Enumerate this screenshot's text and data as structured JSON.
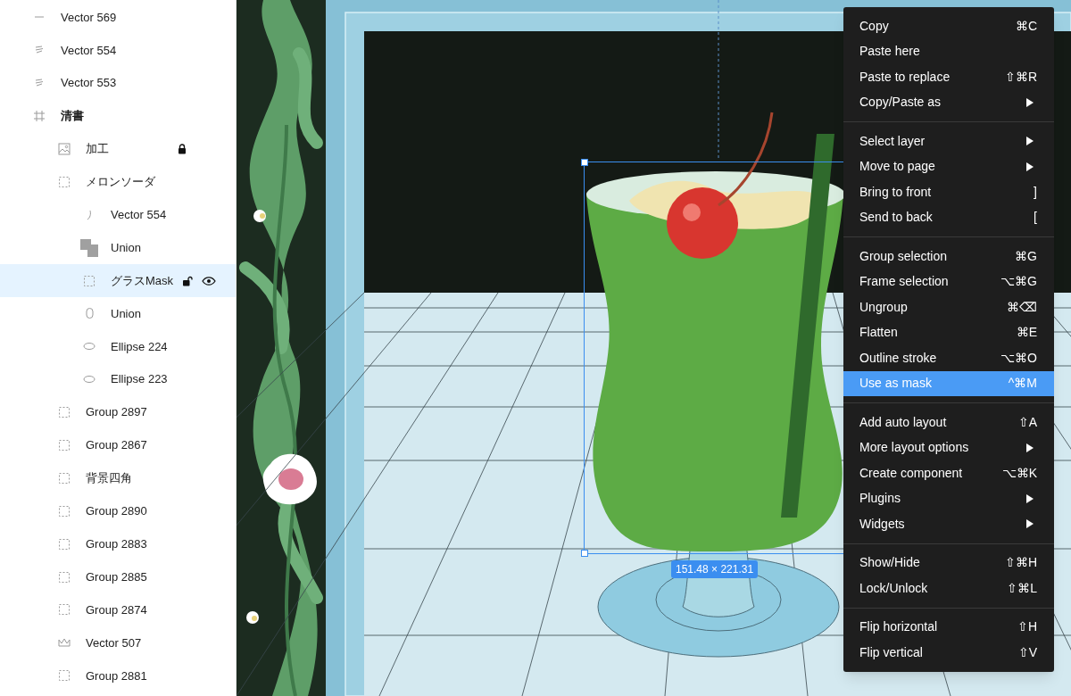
{
  "layers": [
    {
      "children": [
        {
          "name": "Vector 569",
          "kind": "line",
          "selected": false,
          "locked": false,
          "hovered": false
        },
        {
          "name": "Vector 554",
          "kind": "squiggle",
          "selected": false,
          "locked": false,
          "hovered": false
        },
        {
          "name": "Vector 553",
          "kind": "squiggle",
          "selected": false,
          "locked": false,
          "hovered": false
        }
      ]
    },
    {
      "name": "清書",
      "kind": "frame",
      "selected": false,
      "locked": false,
      "hovered": false,
      "children": [
        {
          "name": "加工",
          "kind": "image",
          "selected": false,
          "locked": true,
          "hovered": false
        },
        {
          "name": "メロンソーダ",
          "kind": "group",
          "selected": false,
          "locked": false,
          "hovered": false,
          "children": [
            {
              "name": "Vector 554",
              "kind": "curve",
              "selected": false,
              "locked": false,
              "hovered": false
            },
            {
              "name": "Union",
              "kind": "union",
              "selected": false,
              "locked": false,
              "hovered": false
            },
            {
              "name": "グラスMask",
              "kind": "group",
              "selected": true,
              "locked": false,
              "hovered": true
            },
            {
              "name": "Union",
              "kind": "union-outline",
              "selected": false,
              "locked": false,
              "hovered": false
            },
            {
              "name": "Ellipse 224",
              "kind": "ellipse",
              "selected": false,
              "locked": false,
              "hovered": false
            },
            {
              "name": "Ellipse 223",
              "kind": "ellipse",
              "selected": false,
              "locked": false,
              "hovered": false
            }
          ]
        },
        {
          "name": "Group 2897",
          "kind": "group",
          "selected": false,
          "locked": false,
          "hovered": false
        },
        {
          "name": "Group 2867",
          "kind": "group",
          "selected": false,
          "locked": false,
          "hovered": false
        },
        {
          "name": "背景四角",
          "kind": "group",
          "selected": false,
          "locked": false,
          "hovered": false
        },
        {
          "name": "Group 2890",
          "kind": "group",
          "selected": false,
          "locked": false,
          "hovered": false
        },
        {
          "name": "Group 2883",
          "kind": "group",
          "selected": false,
          "locked": false,
          "hovered": false
        },
        {
          "name": "Group 2885",
          "kind": "group",
          "selected": false,
          "locked": false,
          "hovered": false
        },
        {
          "name": "Group 2874",
          "kind": "group",
          "selected": false,
          "locked": false,
          "hovered": false
        },
        {
          "name": "Vector 507",
          "kind": "crown",
          "selected": false,
          "locked": false,
          "hovered": false
        },
        {
          "name": "Group 2881",
          "kind": "group",
          "selected": false,
          "locked": false,
          "hovered": false
        }
      ]
    }
  ],
  "canvas": {
    "selection_size": "151.48 × 221.31"
  },
  "context_menu": [
    [
      {
        "label": "Copy",
        "shortcut": "⌘C",
        "submenu": false,
        "selected": false
      },
      {
        "label": "Paste here",
        "submenu": false,
        "selected": false
      },
      {
        "label": "Paste to replace",
        "shortcut": "⇧⌘R",
        "submenu": false,
        "selected": false
      },
      {
        "label": "Copy/Paste as",
        "submenu": true,
        "selected": false
      }
    ],
    [
      {
        "label": "Select layer",
        "submenu": true,
        "selected": false
      },
      {
        "label": "Move to page",
        "submenu": true,
        "selected": false
      },
      {
        "label": "Bring to front",
        "shortcut": "]",
        "submenu": false,
        "selected": false
      },
      {
        "label": "Send to back",
        "shortcut": "[",
        "submenu": false,
        "selected": false
      }
    ],
    [
      {
        "label": "Group selection",
        "shortcut": "⌘G",
        "submenu": false,
        "selected": false
      },
      {
        "label": "Frame selection",
        "shortcut": "⌥⌘G",
        "submenu": false,
        "selected": false
      },
      {
        "label": "Ungroup",
        "shortcut": "⌘⌫",
        "submenu": false,
        "selected": false
      },
      {
        "label": "Flatten",
        "shortcut": "⌘E",
        "submenu": false,
        "selected": false
      },
      {
        "label": "Outline stroke",
        "shortcut": "⌥⌘O",
        "submenu": false,
        "selected": false
      },
      {
        "label": "Use as mask",
        "shortcut": "^⌘M",
        "submenu": false,
        "selected": true
      }
    ],
    [
      {
        "label": "Add auto layout",
        "shortcut": "⇧A",
        "submenu": false,
        "selected": false
      },
      {
        "label": "More layout options",
        "submenu": true,
        "selected": false
      },
      {
        "label": "Create component",
        "shortcut": "⌥⌘K",
        "submenu": false,
        "selected": false
      },
      {
        "label": "Plugins",
        "submenu": true,
        "selected": false
      },
      {
        "label": "Widgets",
        "submenu": true,
        "selected": false
      }
    ],
    [
      {
        "label": "Show/Hide",
        "shortcut": "⇧⌘H",
        "submenu": false,
        "selected": false
      },
      {
        "label": "Lock/Unlock",
        "shortcut": "⇧⌘L",
        "submenu": false,
        "selected": false
      }
    ],
    [
      {
        "label": "Flip horizontal",
        "shortcut": "⇧H",
        "submenu": false,
        "selected": false
      },
      {
        "label": "Flip vertical",
        "shortcut": "⇧V",
        "submenu": false,
        "selected": false
      }
    ]
  ]
}
